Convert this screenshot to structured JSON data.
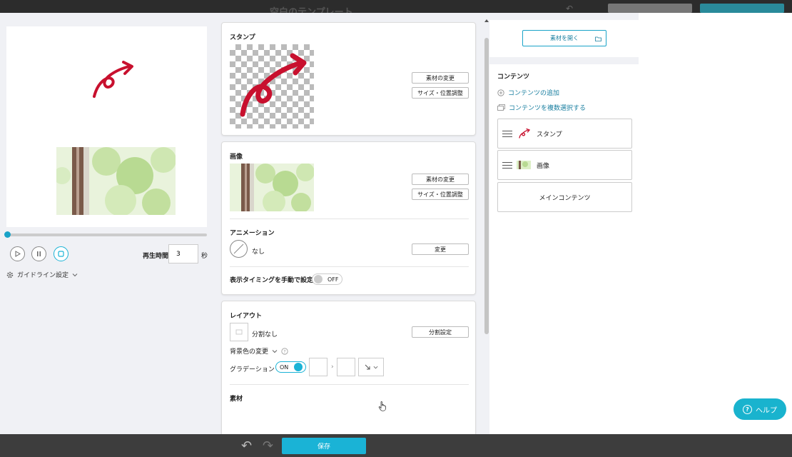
{
  "background": {
    "title": "空白のテンプレート"
  },
  "preview": {
    "playtime_label": "再生時間",
    "playtime_value": "3",
    "playtime_unit": "秒",
    "guideline_label": "ガイドライン設定"
  },
  "stamp_card": {
    "title": "スタンプ",
    "change_button": "素材の変更",
    "adjust_button": "サイズ・位置調整"
  },
  "image_card": {
    "title": "画像",
    "change_button": "素材の変更",
    "adjust_button": "サイズ・位置調整",
    "animation_title": "アニメーション",
    "animation_value": "なし",
    "animation_change_button": "変更",
    "timing_label": "表示タイミングを手動で設定",
    "timing_toggle": "OFF"
  },
  "layout_card": {
    "title": "レイアウト",
    "split_value": "分割なし",
    "split_button": "分割設定",
    "bg_color_label": "背景色の変更",
    "gradation_label": "グラデーション",
    "gradation_toggle": "ON",
    "material_title": "素材"
  },
  "contents": {
    "open_button": "素材を開く",
    "title": "コンテンツ",
    "add_link": "コンテンツの追加",
    "multi_select_link": "コンテンツを複数選択する",
    "items": [
      {
        "label": "スタンプ"
      },
      {
        "label": "画像"
      },
      {
        "label": "メインコンテンツ"
      }
    ]
  },
  "bottombar": {
    "save_button": "保存"
  },
  "help": {
    "label": "ヘルプ"
  },
  "colors": {
    "accent": "#1ab3d6",
    "stamp_red": "#c8102e",
    "link": "#1a7fa0"
  }
}
